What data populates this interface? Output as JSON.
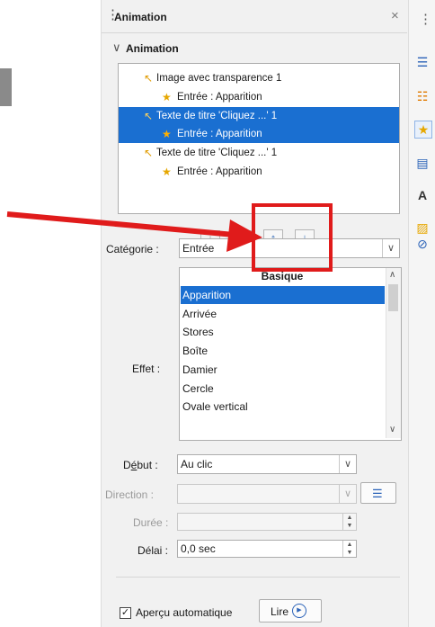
{
  "panel": {
    "title": "Animation",
    "section_title": "Animation"
  },
  "animation_list": [
    {
      "label": "Image avec transparence 1",
      "level": 0,
      "selected": false,
      "icon": "pointer-click-icon"
    },
    {
      "label": "Entrée : Apparition",
      "level": 1,
      "selected": false,
      "icon": "entrance-star-icon"
    },
    {
      "label": "Texte de titre 'Cliquez ...' 1",
      "level": 0,
      "selected": true,
      "icon": "pointer-click-icon"
    },
    {
      "label": "Entrée : Apparition",
      "level": 1,
      "selected": true,
      "icon": "entrance-star-icon"
    },
    {
      "label": "Texte de titre 'Cliquez ...' 1",
      "level": 0,
      "selected": false,
      "icon": "pointer-click-icon"
    },
    {
      "label": "Entrée : Apparition",
      "level": 1,
      "selected": false,
      "icon": "entrance-star-icon"
    }
  ],
  "list_buttons": {
    "add": "+",
    "remove": "−",
    "move_up": "↑",
    "move_down": "↓"
  },
  "categorie": {
    "label": "Catégorie :",
    "value": "Entrée"
  },
  "effet": {
    "label": "Effet :",
    "group_header": "Basique",
    "items": [
      "Apparition",
      "Arrivée",
      "Stores",
      "Boîte",
      "Damier",
      "Cercle",
      "Ovale vertical"
    ],
    "selected_index": 0
  },
  "debut": {
    "label_prefix": "D",
    "label_underlined": "é",
    "label_suffix": "but :",
    "value": "Au clic"
  },
  "direction": {
    "label": "Direction :",
    "value": ""
  },
  "duree": {
    "label": "Durée :",
    "value": ""
  },
  "delai": {
    "label": "Délai :",
    "value": "0,0 sec"
  },
  "apercu": {
    "label": "Aperçu automatique",
    "checked": true
  },
  "lire_button": {
    "label": "Lire"
  },
  "colors": {
    "selection": "#1a6fd1",
    "annotation_red": "#e01b1b"
  }
}
